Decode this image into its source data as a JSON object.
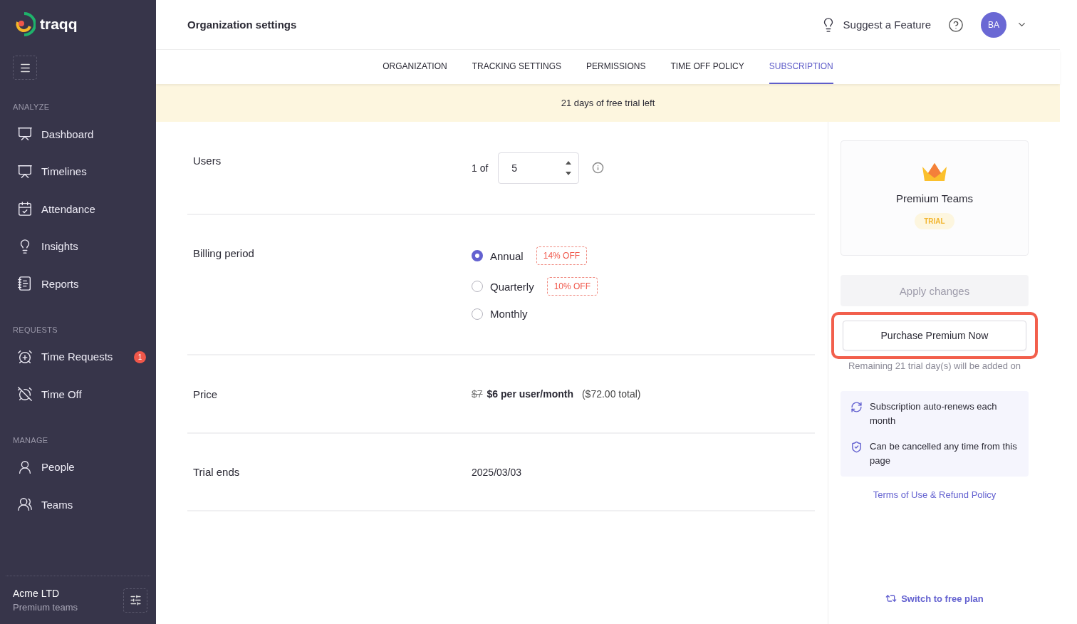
{
  "logo": {
    "text": "traqq"
  },
  "sidebar": {
    "sections": [
      {
        "heading": "ANALYZE",
        "items": [
          {
            "label": "Dashboard"
          },
          {
            "label": "Timelines"
          },
          {
            "label": "Attendance"
          },
          {
            "label": "Insights"
          },
          {
            "label": "Reports"
          }
        ]
      },
      {
        "heading": "REQUESTS",
        "items": [
          {
            "label": "Time Requests",
            "badge": "1"
          },
          {
            "label": "Time Off"
          }
        ]
      },
      {
        "heading": "MANAGE",
        "items": [
          {
            "label": "People"
          },
          {
            "label": "Teams"
          }
        ]
      }
    ],
    "org": {
      "name": "Acme LTD",
      "plan": "Premium teams"
    }
  },
  "header": {
    "title": "Organization settings",
    "suggest": "Suggest a Feature",
    "avatar": "BA"
  },
  "tabs": [
    {
      "label": "ORGANIZATION",
      "selected": false
    },
    {
      "label": "TRACKING SETTINGS",
      "selected": false
    },
    {
      "label": "PERMISSIONS",
      "selected": false
    },
    {
      "label": "TIME OFF POLICY",
      "selected": false
    },
    {
      "label": "SUBSCRIPTION",
      "selected": true
    }
  ],
  "banner": "21 days of free trial left",
  "settings": {
    "users": {
      "label": "Users",
      "prefix": "1 of",
      "value": "5"
    },
    "billing": {
      "label": "Billing period",
      "options": [
        {
          "label": "Annual",
          "selected": true,
          "discount": "14% OFF"
        },
        {
          "label": "Quarterly",
          "selected": false,
          "discount": "10% OFF"
        },
        {
          "label": "Monthly",
          "selected": false
        }
      ]
    },
    "price": {
      "label": "Price",
      "old": "$7",
      "current": "$6 per user/month",
      "total": "($72.00 total)"
    },
    "trial": {
      "label": "Trial ends",
      "value": "2025/03/03"
    }
  },
  "plan_card": {
    "name": "Premium Teams",
    "badge": "TRIAL"
  },
  "apply_button": {
    "label": "Apply changes",
    "disabled": true
  },
  "purchase_button": {
    "label": "Purchase Premium Now",
    "highlighted": true
  },
  "remaining_note": "Remaining 21 trial day(s) will be added on",
  "notes": [
    {
      "kind": "renew",
      "text": "Subscription auto-renews each month"
    },
    {
      "kind": "cancel",
      "text": "Can be cancelled any time from this page"
    }
  ],
  "terms_link": "Terms of Use & Refund Policy",
  "switch_link": "Switch to free plan"
}
